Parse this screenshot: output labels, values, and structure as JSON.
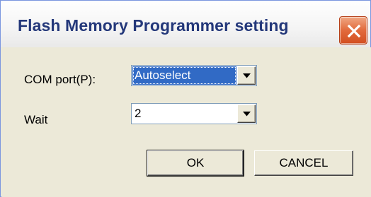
{
  "window": {
    "title": "Flash Memory Programmer setting"
  },
  "form": {
    "com_port_label": "COM port(P):",
    "com_port_value": "Autoselect",
    "wait_label": "Wait",
    "wait_value": "2"
  },
  "buttons": {
    "ok_label": "OK",
    "cancel_label": "CANCEL"
  },
  "icons": {
    "close": "close-icon",
    "dropdown": "chevron-down-icon"
  },
  "colors": {
    "title_text": "#24387a",
    "close_button": "#e26a3c",
    "selection": "#316ac5",
    "dialog_background": "#ece9d8"
  }
}
